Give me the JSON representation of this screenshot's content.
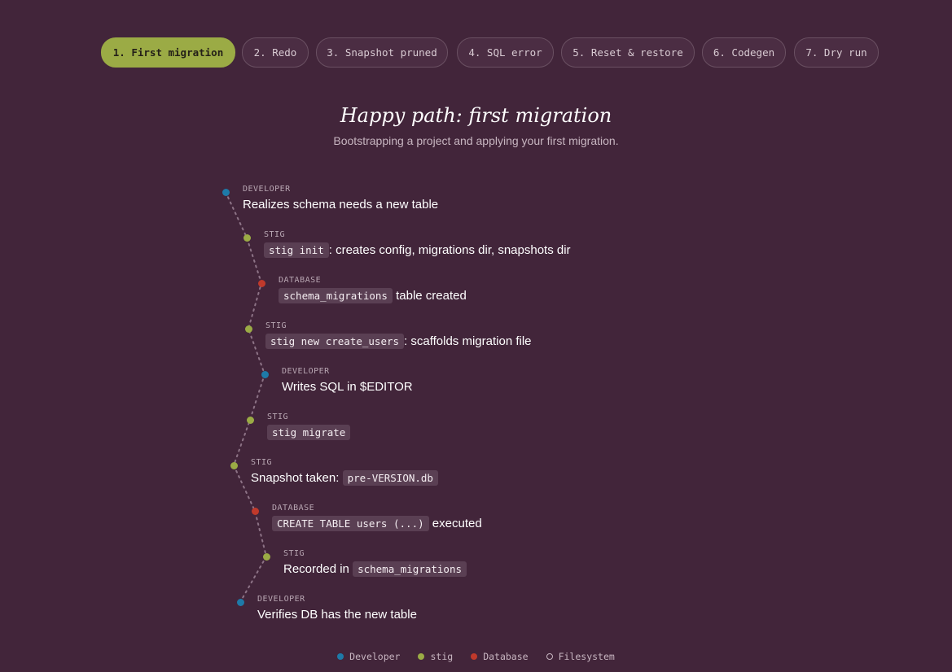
{
  "tabs": [
    {
      "label": "1. First migration",
      "active": true
    },
    {
      "label": "2. Redo",
      "active": false
    },
    {
      "label": "3. Snapshot pruned",
      "active": false
    },
    {
      "label": "4. SQL error",
      "active": false
    },
    {
      "label": "5. Reset & restore",
      "active": false
    },
    {
      "label": "6. Codegen",
      "active": false
    },
    {
      "label": "7. Dry run",
      "active": false
    }
  ],
  "title": "Happy path: first migration",
  "subtitle": "Bootstrapping a project and applying your first migration.",
  "colors": {
    "developer": "#1e7aa8",
    "stig": "#9bab45",
    "database": "#c0392b",
    "filesystem": "#c7b5c0",
    "connector": "#8d7386"
  },
  "steps": [
    {
      "actor": "DEVELOPER",
      "role": "developer",
      "parts": [
        {
          "t": "Realizes schema needs a new table"
        }
      ]
    },
    {
      "actor": "STIG",
      "role": "stig",
      "parts": [
        {
          "code": "stig init"
        },
        {
          "t": ": creates config, migrations dir, snapshots dir"
        }
      ]
    },
    {
      "actor": "DATABASE",
      "role": "database",
      "parts": [
        {
          "code": "schema_migrations"
        },
        {
          "t": " table created"
        }
      ]
    },
    {
      "actor": "STIG",
      "role": "stig",
      "parts": [
        {
          "code": "stig new create_users"
        },
        {
          "t": ": scaffolds migration file"
        }
      ]
    },
    {
      "actor": "DEVELOPER",
      "role": "developer",
      "parts": [
        {
          "t": "Writes SQL in $EDITOR"
        }
      ]
    },
    {
      "actor": "STIG",
      "role": "stig",
      "parts": [
        {
          "code": "stig migrate"
        }
      ]
    },
    {
      "actor": "STIG",
      "role": "stig",
      "parts": [
        {
          "t": "Snapshot taken: "
        },
        {
          "code": "pre-VERSION.db"
        }
      ]
    },
    {
      "actor": "DATABASE",
      "role": "database",
      "parts": [
        {
          "code": "CREATE TABLE users (...)"
        },
        {
          "t": " executed"
        }
      ]
    },
    {
      "actor": "STIG",
      "role": "stig",
      "parts": [
        {
          "t": "Recorded in "
        },
        {
          "code": "schema_migrations"
        }
      ]
    },
    {
      "actor": "DEVELOPER",
      "role": "developer",
      "parts": [
        {
          "t": "Verifies DB has the new table"
        }
      ]
    }
  ],
  "legend": [
    {
      "label": "Developer",
      "role": "developer"
    },
    {
      "label": "stig",
      "role": "stig"
    },
    {
      "label": "Database",
      "role": "database"
    },
    {
      "label": "Filesystem",
      "role": "filesystem",
      "hollow": true
    }
  ]
}
